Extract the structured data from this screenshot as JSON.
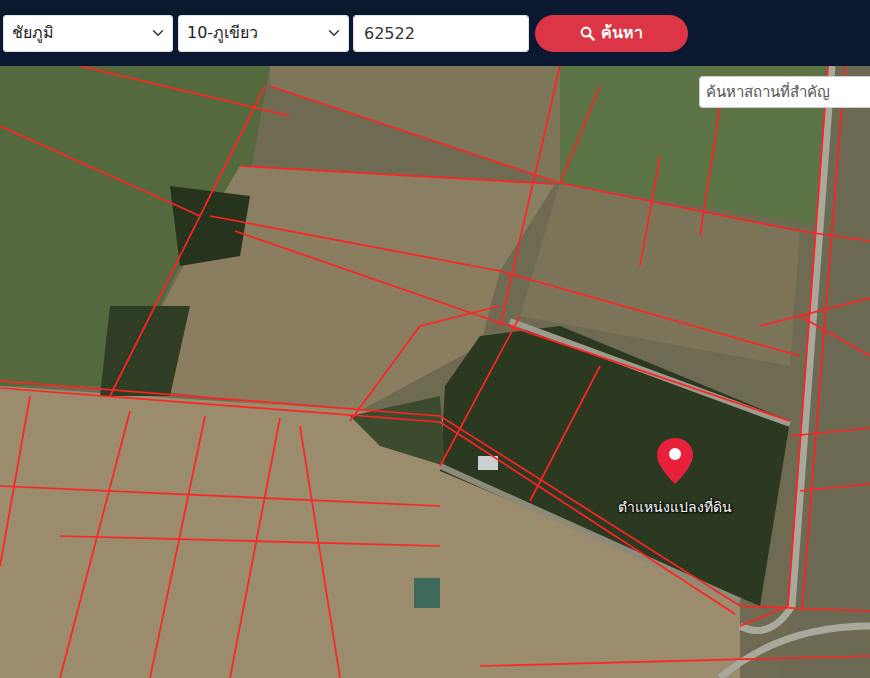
{
  "filters": {
    "province": "ชัยภูมิ",
    "district": "10-ภูเขียว",
    "parcel_number": "62522"
  },
  "search_button": {
    "label": "ค้นหา"
  },
  "landmark_search": {
    "placeholder": "ค้นหาสถานที่สำคัญ"
  },
  "marker": {
    "label": "ตำแหน่งแปลงที่ดิน"
  }
}
